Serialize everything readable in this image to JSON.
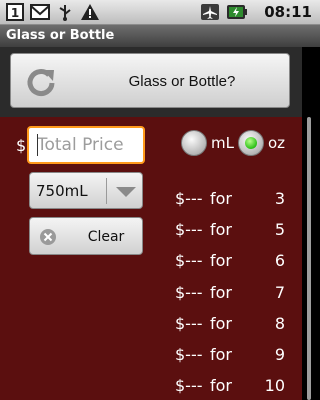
{
  "status_bar": {
    "icons": [
      "notification-1-icon",
      "gmail-icon",
      "usb-icon",
      "warning-icon",
      "airplane-icon",
      "battery-icon"
    ],
    "time": "08:11"
  },
  "app": {
    "title": "Glass or Bottle"
  },
  "header": {
    "main_button_label": "Glass or Bottle?"
  },
  "form": {
    "currency_symbol": "$",
    "price_placeholder": "Total Price",
    "size_selected": "750mL",
    "clear_label": "Clear",
    "unit_ml_label": "mL",
    "unit_oz_label": "oz",
    "selected_unit": "oz"
  },
  "results": [
    {
      "price": "$---",
      "for": "for",
      "count": "3"
    },
    {
      "price": "$---",
      "for": "for",
      "count": "5"
    },
    {
      "price": "$---",
      "for": "for",
      "count": "6"
    },
    {
      "price": "$---",
      "for": "for",
      "count": "7"
    },
    {
      "price": "$---",
      "for": "for",
      "count": "8"
    },
    {
      "price": "$---",
      "for": "for",
      "count": "9"
    },
    {
      "price": "$---",
      "for": "for",
      "count": "10"
    }
  ],
  "colors": {
    "content_bg": "#5b0f0f",
    "focus_border": "#ff9a1c",
    "radio_selected": "#2bbf16"
  }
}
